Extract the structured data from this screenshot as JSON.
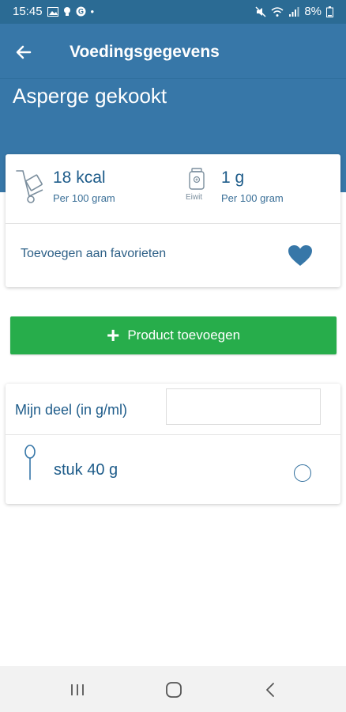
{
  "status_bar": {
    "time": "15:45",
    "battery": "8%",
    "left_icons": [
      "image-icon",
      "bulb-icon",
      "g-icon",
      "dot-icon"
    ],
    "right_icons": [
      "mute-icon",
      "wifi-icon",
      "signal-icon",
      "battery-icon"
    ]
  },
  "app_bar": {
    "title": "Voedingsgegevens",
    "back_icon": "arrow-left-icon"
  },
  "product": {
    "name": "Asperge gekookt"
  },
  "nutrition": {
    "kcal_value": "18 kcal",
    "kcal_sub": "Per 100 gram",
    "protein_icon_label": "Eiwit",
    "protein_value": "1 g",
    "protein_sub": "Per 100 gram"
  },
  "favorites": {
    "label": "Toevoegen aan favorieten",
    "icon": "heart-icon"
  },
  "add_button": {
    "label": "Product toevoegen",
    "icon": "plus-icon"
  },
  "portion": {
    "label": "Mijn deel (in g/ml)",
    "input_value": "",
    "options": [
      {
        "label": "stuk 40 g",
        "selected": false
      }
    ]
  },
  "colors": {
    "header": "#3777a8",
    "status_bar": "#2b6b94",
    "accent_text": "#1e5c8a",
    "add_button": "#27ad4b"
  }
}
